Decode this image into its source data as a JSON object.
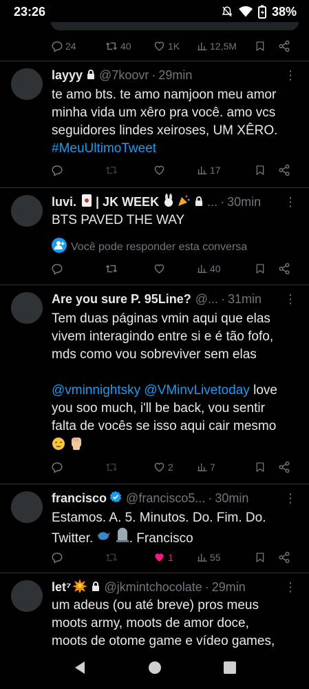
{
  "status_bar": {
    "time": "23:26",
    "battery": "38%"
  },
  "previous_tweet": {
    "replies": "24",
    "retweets": "40",
    "likes": "1K",
    "views": "12,5M"
  },
  "tweets": [
    {
      "name": "layyy",
      "handle": "@7koovr",
      "time": "29min",
      "text_lines": [
        "te amo bts. te amo namjoon meu amor",
        "minha vida um xêro pra você. amo vcs",
        "seguidores lindes xeiroses, UM XÊRO."
      ],
      "hashtag": "#MeuUltimoTweet",
      "views": "17"
    },
    {
      "name": "luvi.",
      "name_suffix": "| JK WEEK",
      "handle": "...",
      "time": "30min",
      "text": "BTS PAVED THE WAY",
      "reply_note": "Você pode responder esta conversa",
      "views": "40"
    },
    {
      "name": "Are you sure P. 95Line?",
      "handle": "@...",
      "time": "31min",
      "text_lines": [
        "Tem duas páginas vmin aqui que elas",
        "vivem interagindo entre si e é tão fofo,",
        "mds como vou sobreviver sem elas"
      ],
      "mention1": "@vminnightsky",
      "mention2": "@VMinvLivetoday",
      "text_after_mentions": " love",
      "text_lines_2": [
        "you soo much, i'll be back, vou sentir",
        "falta de vocês se isso aqui cair mesmo"
      ],
      "likes": "2",
      "views": "7"
    },
    {
      "name": "francisco",
      "handle": "@francisco5...",
      "time": "30min",
      "text_lines": [
        "Estamos. A. 5. Minutos. Do. Fim. Do."
      ],
      "text_line2_a": "Twitter.",
      "text_line2_b": ". Francisco",
      "likes": "1",
      "views": "55"
    },
    {
      "name": "let⁷",
      "handle": "@jkmintchocolate",
      "time": "29min",
      "text_lines": [
        "um adeus (ou até breve) pros meus",
        "moots army, moots de amor doce,",
        "moots de otome game e vídeo games,"
      ]
    }
  ],
  "colors": {
    "background": "#000000",
    "text": "#e7e9ea",
    "secondary": "#71767b",
    "link": "#1d9bf0",
    "like_active": "#f91880",
    "divider": "#2f3336"
  }
}
